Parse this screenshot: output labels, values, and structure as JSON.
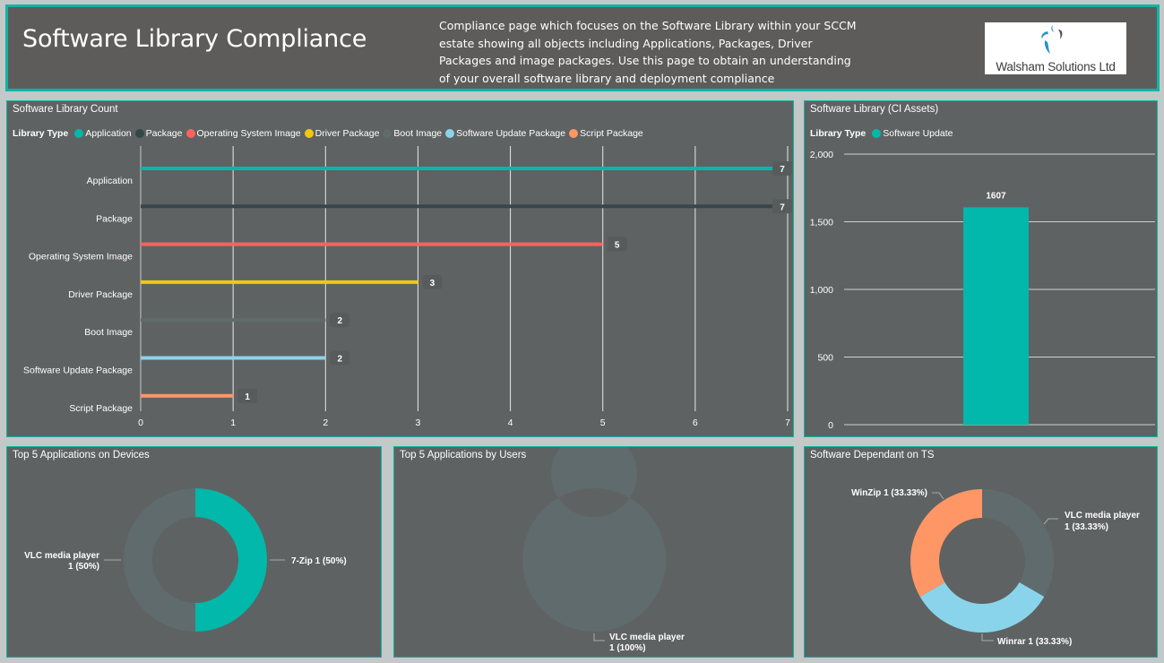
{
  "header": {
    "title": "Software Library Compliance",
    "description": "Compliance page which focuses on the Software Library within your SCCM estate showing all objects including Applications, Packages, Driver Packages and image packages. Use this page to obtain an understanding of your overall software library and deployment compliance",
    "logo_text": "Walsham Solutions Ltd",
    "accent_color": "#12b3a5"
  },
  "chart_data": [
    {
      "id": "software-library-count",
      "type": "bar",
      "orientation": "horizontal",
      "title": "Software Library Count",
      "legend_title": "Library Type",
      "legend_position": "top-left",
      "categories": [
        "Application",
        "Package",
        "Operating System Image",
        "Driver Package",
        "Boot Image",
        "Software Update Package",
        "Script Package"
      ],
      "values": [
        7,
        7,
        5,
        3,
        2,
        2,
        1
      ],
      "colors": [
        "#01b8aa",
        "#374649",
        "#fd625e",
        "#f2c80f",
        "#5f6b6d",
        "#8ad4eb",
        "#fe9666"
      ],
      "xlim": [
        0,
        7
      ],
      "xticks": [
        "0",
        "1",
        "2",
        "3",
        "4",
        "5",
        "6",
        "7"
      ],
      "grid": true,
      "xlabel": "",
      "ylabel": ""
    },
    {
      "id": "software-library-ci-assets",
      "type": "bar",
      "title": "Software Library (CI Assets)",
      "legend_title": "Library Type",
      "legend_position": "top-left",
      "series": [
        {
          "name": "Software Update",
          "values": [
            1607
          ],
          "color": "#01b8aa"
        }
      ],
      "categories": [
        "Software Update"
      ],
      "data_labels": [
        "1607"
      ],
      "ylim": [
        0,
        2000
      ],
      "yticks": [
        "0",
        "500",
        "1,000",
        "1,500",
        "2,000"
      ],
      "grid": true,
      "xlabel": "",
      "ylabel": ""
    },
    {
      "id": "top5-apps-devices",
      "type": "pie",
      "donut": true,
      "title": "Top 5 Applications on Devices",
      "slices": [
        {
          "label": "7-Zip",
          "value": 1,
          "percent": "50%",
          "color": "#01b8aa",
          "label_text": "7-Zip 1 (50%)"
        },
        {
          "label": "VLC media player",
          "value": 1,
          "percent": "50%",
          "color": "#5f6b6d",
          "label_line1": "VLC media player",
          "label_line2": "1 (50%)"
        }
      ]
    },
    {
      "id": "top5-apps-users",
      "type": "pie",
      "donut": true,
      "title": "Top 5 Applications by Users",
      "slices": [
        {
          "label": "VLC media player",
          "value": 1,
          "percent": "100%",
          "color": "#5f6b6d",
          "label_line1": "VLC media player",
          "label_line2": "1 (100%)"
        }
      ]
    },
    {
      "id": "software-dependant-ts",
      "type": "pie",
      "donut": true,
      "title": "Software Dependant on TS",
      "slices": [
        {
          "label": "VLC media player",
          "value": 1,
          "percent": "33.33%",
          "color": "#5f6b6d",
          "label_line1": "VLC media player",
          "label_line2": "1 (33.33%)"
        },
        {
          "label": "Winrar",
          "value": 1,
          "percent": "33.33%",
          "color": "#8ad4eb",
          "label_text": "Winrar 1 (33.33%)"
        },
        {
          "label": "WinZip",
          "value": 1,
          "percent": "33.33%",
          "color": "#fe9666",
          "label_text": "WinZip 1 (33.33%)"
        }
      ]
    }
  ]
}
